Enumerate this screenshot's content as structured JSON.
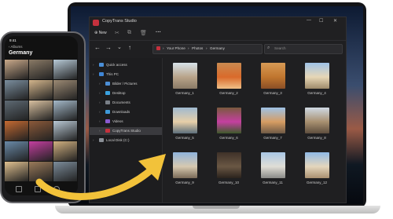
{
  "window": {
    "title": "CopyTrans Studio",
    "new_label": "New",
    "breadcrumb": [
      "Your Phone",
      "Photos",
      "Germany"
    ],
    "search_placeholder": "Search",
    "minimize_glyph": "—",
    "maximize_glyph": "☐",
    "close_glyph": "✕"
  },
  "toolbar_icons": [
    "cut-icon",
    "copy-icon",
    "delete-icon",
    "more-icon"
  ],
  "sidebar": {
    "items": [
      {
        "label": "Quick access",
        "icon": "star-icon",
        "color": "#4a8fd8"
      },
      {
        "label": "This PC",
        "icon": "pc-icon",
        "color": "#3f86d6"
      },
      {
        "label": "Bilder / Pictures",
        "icon": "pictures-icon",
        "color": "#4c8fd6"
      },
      {
        "label": "Desktop",
        "icon": "desktop-icon",
        "color": "#3aa2e0"
      },
      {
        "label": "Documents",
        "icon": "documents-icon",
        "color": "#7a8088"
      },
      {
        "label": "Downloads",
        "icon": "downloads-icon",
        "color": "#3f9ad9"
      },
      {
        "label": "Videos",
        "icon": "videos-icon",
        "color": "#8a5ad0"
      },
      {
        "label": "CopyTrans Studio",
        "icon": "copytrans-icon",
        "color": "#c6313d"
      },
      {
        "label": "Local Disk (C:)",
        "icon": "disk-icon",
        "color": "#8a8f96"
      }
    ],
    "selected_index": 7
  },
  "photos": [
    {
      "caption": "Germany_1",
      "colors": [
        "#d7e2ea",
        "#b9a48a",
        "#8a7a66"
      ]
    },
    {
      "caption": "Germany_2",
      "colors": [
        "#c98a50",
        "#d96a2b",
        "#f0c088"
      ]
    },
    {
      "caption": "Germany_3",
      "colors": [
        "#d79a55",
        "#c0762e",
        "#8a4e26"
      ]
    },
    {
      "caption": "Germany_4",
      "colors": [
        "#9fc3e8",
        "#e7d7b6",
        "#9e8a6a"
      ]
    },
    {
      "caption": "Germany_5",
      "colors": [
        "#9fb9d0",
        "#e7cfa8",
        "#5d6f7c"
      ]
    },
    {
      "caption": "Germany_6",
      "colors": [
        "#7a5a3e",
        "#c43fa0",
        "#3e5a2a"
      ]
    },
    {
      "caption": "Germany_7",
      "colors": [
        "#9ec2e6",
        "#d69d63",
        "#6e5a46"
      ]
    },
    {
      "caption": "Germany_8",
      "colors": [
        "#cfd9e4",
        "#a89070",
        "#5e4e3e"
      ]
    },
    {
      "caption": "Germany_9",
      "colors": [
        "#8fb3dc",
        "#d7c9b0",
        "#7a6a58"
      ]
    },
    {
      "caption": "Germany_10",
      "colors": [
        "#3e3128",
        "#6a5744",
        "#2a221c"
      ]
    },
    {
      "caption": "Germany_11",
      "colors": [
        "#a9c6e5",
        "#e0ded6",
        "#8a8a88"
      ]
    },
    {
      "caption": "Germany_12",
      "colors": [
        "#8fb9e6",
        "#e4d6bc",
        "#a99070"
      ]
    }
  ],
  "phone": {
    "status_time": "9:41",
    "back_label": "‹ Albums",
    "album_title": "Germany",
    "grid_colors": [
      [
        "#c9a98a",
        "#8a7a66",
        "#b7c9d6"
      ],
      [
        "#7b8e9e",
        "#d3b58c",
        "#9c8a74"
      ],
      [
        "#5e6a74",
        "#d8c0a0",
        "#a4b8c8"
      ],
      [
        "#c46a32",
        "#8c5a3a",
        "#b9c8d4"
      ],
      [
        "#6a8aa8",
        "#c43fa0",
        "#d0b080"
      ],
      [
        "#e0c090",
        "#9a7a5a",
        "#7c8c9a"
      ]
    ]
  },
  "colors": {
    "accent_red": "#c6313d",
    "arrow_yellow": "#f2c23a"
  }
}
